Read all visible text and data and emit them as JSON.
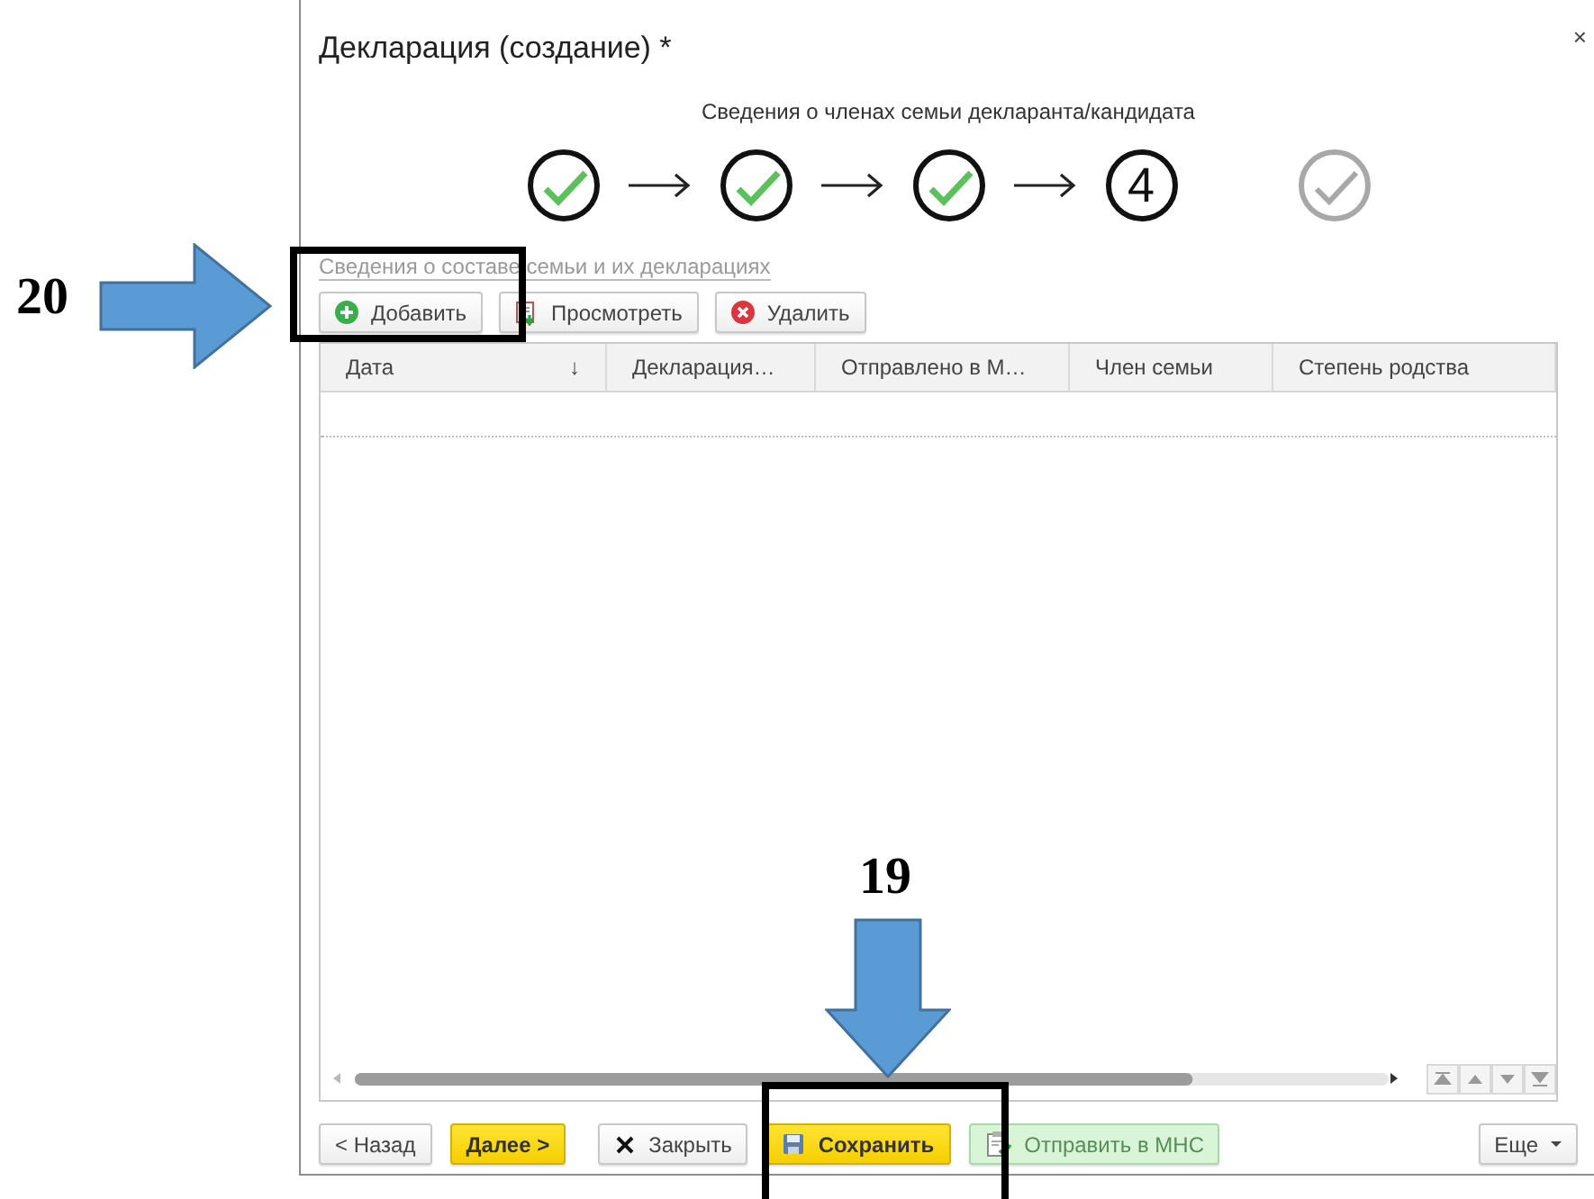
{
  "window": {
    "title": "Декларация (создание) *",
    "close": "×"
  },
  "wizard": {
    "caption": "Сведения о членах семьи декларанта/кандидата",
    "steps": [
      {
        "kind": "done"
      },
      {
        "kind": "done"
      },
      {
        "kind": "done"
      },
      {
        "kind": "current",
        "label": "4"
      },
      {
        "kind": "pending"
      }
    ]
  },
  "section_link": "Сведения о составе семьи и их декларациях",
  "toolbar": [
    {
      "kind": "add",
      "label": "Добавить"
    },
    {
      "kind": "view",
      "label": "Просмотреть"
    },
    {
      "kind": "delete",
      "label": "Удалить"
    }
  ],
  "table": {
    "columns": [
      {
        "label": "Дата",
        "sort": "↓"
      },
      {
        "label": "Декларация…"
      },
      {
        "label": "Отправлено в М…"
      },
      {
        "label": "Член семьи"
      },
      {
        "label": "Степень родства"
      }
    ]
  },
  "footer": [
    {
      "kind": "back",
      "label": "< Назад"
    },
    {
      "kind": "next",
      "label": "Далее >"
    },
    {
      "kind": "close",
      "label": "Закрыть"
    },
    {
      "kind": "save",
      "label": "Сохранить"
    },
    {
      "kind": "send",
      "label": "Отправить в МНС"
    },
    {
      "kind": "more",
      "label": "Еще"
    }
  ],
  "annotations": [
    {
      "label": "20",
      "kind": "right"
    },
    {
      "label": "19",
      "kind": "down"
    }
  ]
}
